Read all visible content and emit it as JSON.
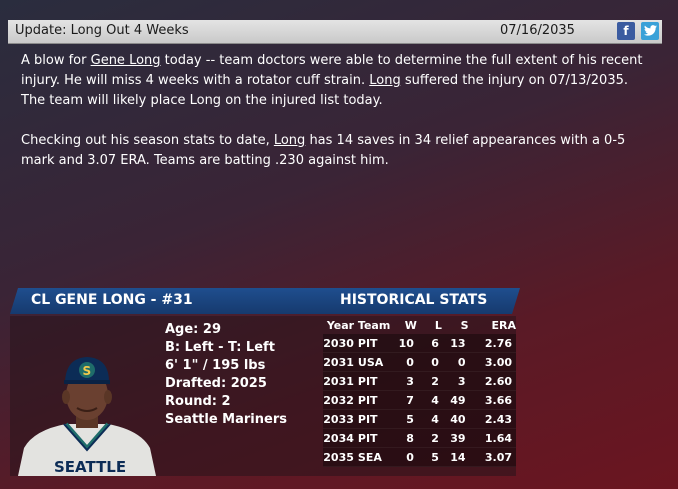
{
  "update": {
    "title": "Update: Long Out 4 Weeks",
    "date": "07/16/2035",
    "facebook_label": "f"
  },
  "article": {
    "p1_a": "A blow for ",
    "p1_name": "Gene Long",
    "p1_b": " today -- team doctors were able to determine the full extent of his recent injury. He will miss 4 weeks with a rotator cuff strain. ",
    "p1_long": "Long",
    "p1_c": " suffered the injury on 07/13/2035. The team will likely place Long on the injured list today.",
    "p2_a": "Checking out his season stats to date, ",
    "p2_long": "Long",
    "p2_b": " has 14 saves in 34 relief appearances with a 0-5 mark and 3.07 ERA. Teams are batting .230 against him."
  },
  "player": {
    "header": "CL GENE LONG - #31",
    "hist_header": "HISTORICAL STATS",
    "age": "Age: 29",
    "bats_throws": "B: Left - T: Left",
    "height_weight": "6' 1\" / 195 lbs",
    "drafted": "Drafted: 2025",
    "round": "Round: 2",
    "team": "Seattle Mariners",
    "jersey_text": "SEATTLE",
    "cap_letter": "S"
  },
  "stats": {
    "columns": [
      "Year",
      "Team",
      "W",
      "L",
      "S",
      "ERA"
    ],
    "rows": [
      [
        "2030",
        "PIT",
        "10",
        "6",
        "13",
        "2.76"
      ],
      [
        "2031",
        "USA",
        "0",
        "0",
        "0",
        "3.00"
      ],
      [
        "2031",
        "PIT",
        "3",
        "2",
        "3",
        "2.60"
      ],
      [
        "2032",
        "PIT",
        "7",
        "4",
        "49",
        "3.66"
      ],
      [
        "2033",
        "PIT",
        "5",
        "4",
        "40",
        "2.43"
      ],
      [
        "2034",
        "PIT",
        "8",
        "2",
        "39",
        "1.64"
      ],
      [
        "2035",
        "SEA",
        "0",
        "5",
        "14",
        "3.07"
      ]
    ]
  }
}
